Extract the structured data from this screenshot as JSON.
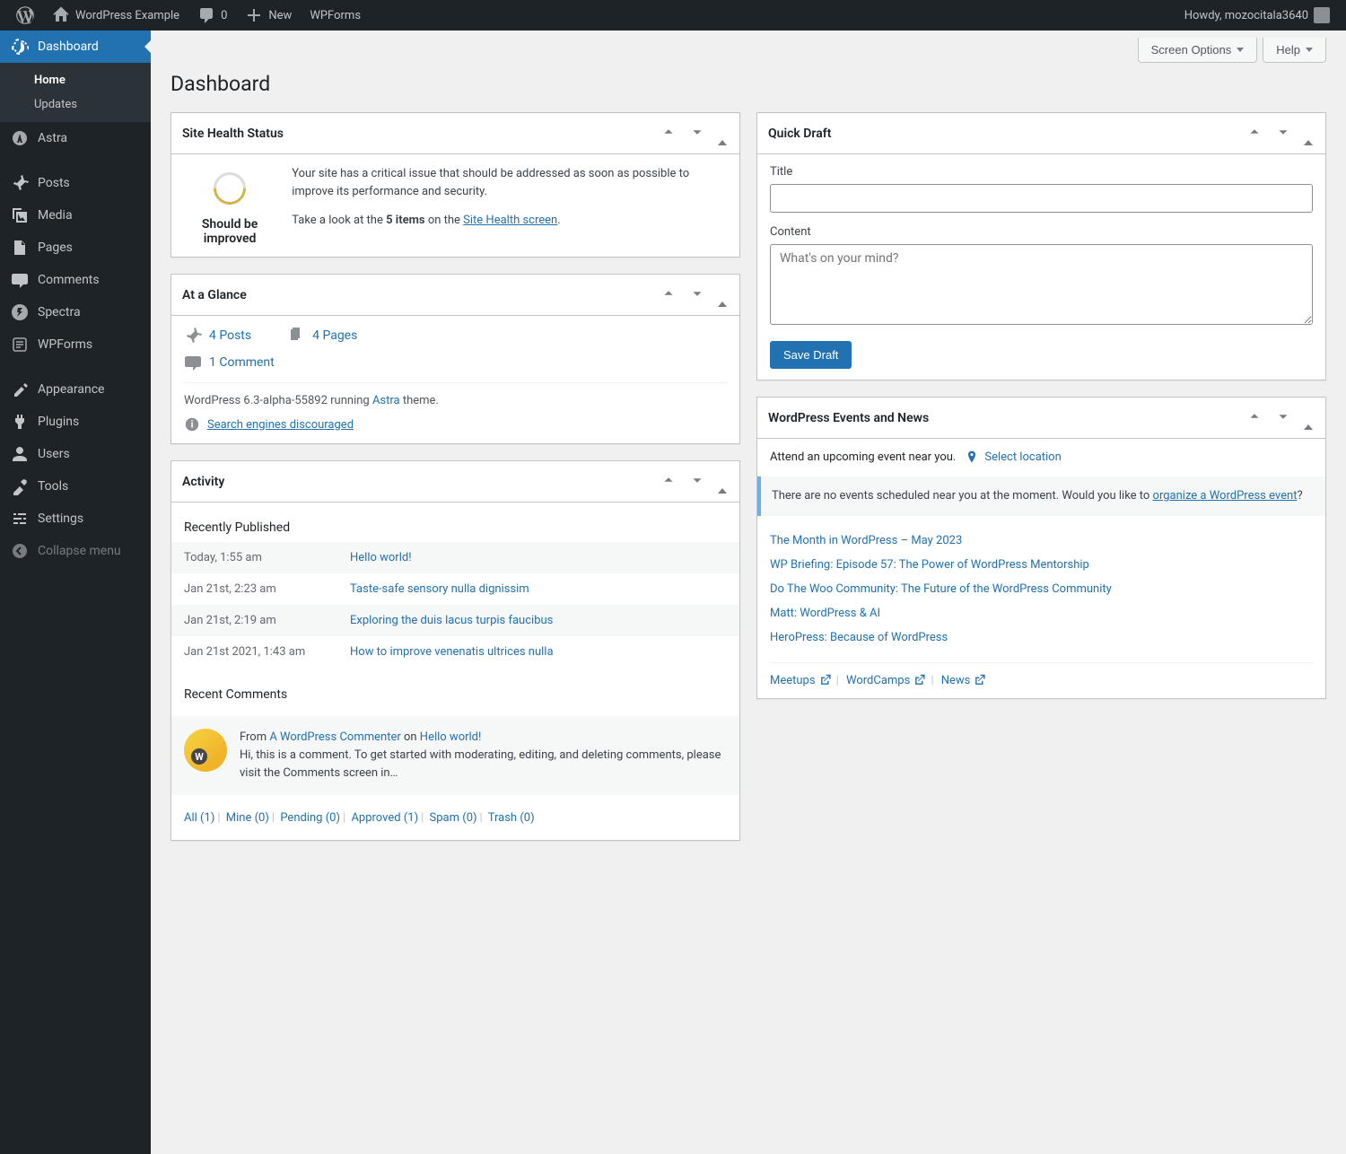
{
  "adminbar": {
    "site_name": "WordPress Example",
    "comment_count": "0",
    "new_label": "New",
    "wpforms_label": "WPForms",
    "howdy": "Howdy, mozocitala3640"
  },
  "sidebar": {
    "dashboard": "Dashboard",
    "home": "Home",
    "updates": "Updates",
    "astra": "Astra",
    "posts": "Posts",
    "media": "Media",
    "pages": "Pages",
    "comments": "Comments",
    "spectra": "Spectra",
    "wpforms": "WPForms",
    "appearance": "Appearance",
    "plugins": "Plugins",
    "users": "Users",
    "tools": "Tools",
    "settings": "Settings",
    "collapse": "Collapse menu"
  },
  "top": {
    "screen_options": "Screen Options",
    "help": "Help"
  },
  "page_title": "Dashboard",
  "site_health": {
    "title": "Site Health Status",
    "status_label": "Should be improved",
    "msg": "Your site has a critical issue that should be addressed as soon as possible to improve its performance and security.",
    "lead": "Take a look at the ",
    "count": "5 items",
    "mid": " on the ",
    "link": "Site Health screen",
    "end": "."
  },
  "glance": {
    "title": "At a Glance",
    "posts": "4 Posts",
    "pages": "4 Pages",
    "comments": "1 Comment",
    "version_pre": "WordPress 6.3-alpha-55892 running ",
    "theme": "Astra",
    "version_post": " theme.",
    "search_link": "Search engines discouraged"
  },
  "activity": {
    "title": "Activity",
    "recently_published": "Recently Published",
    "rows": [
      {
        "date": "Today, 1:55 am",
        "title": "Hello world!"
      },
      {
        "date": "Jan 21st, 2:23 am",
        "title": "Taste-safe sensory nulla dignissim"
      },
      {
        "date": "Jan 21st, 2:19 am",
        "title": "Exploring the duis lacus turpis faucibus"
      },
      {
        "date": "Jan 21st 2021, 1:43 am",
        "title": "How to improve venenatis ultrices nulla"
      }
    ],
    "recent_comments": "Recent Comments",
    "comment": {
      "from": "From ",
      "author": "A WordPress Commenter",
      "on": " on ",
      "post": "Hello world!",
      "body": "Hi, this is a comment. To get started with moderating, editing, and deleting comments, please visit the Comments screen in…"
    },
    "filters": {
      "all": "All",
      "mine": "Mine",
      "pending": "Pending",
      "approved": "Approved",
      "spam": "Spam",
      "trash": "Trash"
    },
    "counts": {
      "all": "1",
      "mine": "0",
      "pending": "0",
      "approved": "1",
      "spam": "0",
      "trash": "0"
    }
  },
  "quickdraft": {
    "title": "Quick Draft",
    "title_label": "Title",
    "content_label": "Content",
    "content_placeholder": "What's on your mind?",
    "save": "Save Draft"
  },
  "events": {
    "title": "WordPress Events and News",
    "attend": "Attend an upcoming event near you.",
    "select_location": "Select location",
    "none_pre": "There are no events scheduled near you at the moment. Would you like to ",
    "none_link": "organize a WordPress event",
    "none_post": "?",
    "news": [
      "The Month in WordPress – May 2023",
      "WP Briefing: Episode 57: The Power of WordPress Mentorship",
      "Do The Woo Community: The Future of the WordPress Community",
      "Matt: WordPress & AI",
      "HeroPress: Because of WordPress"
    ],
    "meetups": "Meetups",
    "wordcamps": "WordCamps",
    "news_link": "News"
  }
}
